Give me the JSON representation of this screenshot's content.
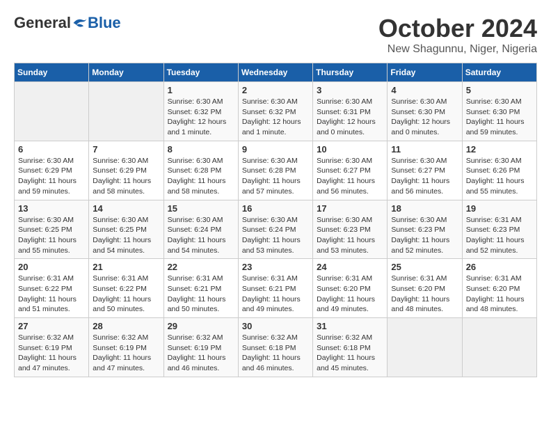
{
  "logo": {
    "general": "General",
    "blue": "Blue"
  },
  "title": "October 2024",
  "location": "New Shagunnu, Niger, Nigeria",
  "days_header": [
    "Sunday",
    "Monday",
    "Tuesday",
    "Wednesday",
    "Thursday",
    "Friday",
    "Saturday"
  ],
  "weeks": [
    [
      {
        "day": "",
        "info": ""
      },
      {
        "day": "",
        "info": ""
      },
      {
        "day": "1",
        "info": "Sunrise: 6:30 AM\nSunset: 6:32 PM\nDaylight: 12 hours\nand 1 minute."
      },
      {
        "day": "2",
        "info": "Sunrise: 6:30 AM\nSunset: 6:32 PM\nDaylight: 12 hours\nand 1 minute."
      },
      {
        "day": "3",
        "info": "Sunrise: 6:30 AM\nSunset: 6:31 PM\nDaylight: 12 hours\nand 0 minutes."
      },
      {
        "day": "4",
        "info": "Sunrise: 6:30 AM\nSunset: 6:30 PM\nDaylight: 12 hours\nand 0 minutes."
      },
      {
        "day": "5",
        "info": "Sunrise: 6:30 AM\nSunset: 6:30 PM\nDaylight: 11 hours\nand 59 minutes."
      }
    ],
    [
      {
        "day": "6",
        "info": "Sunrise: 6:30 AM\nSunset: 6:29 PM\nDaylight: 11 hours\nand 59 minutes."
      },
      {
        "day": "7",
        "info": "Sunrise: 6:30 AM\nSunset: 6:29 PM\nDaylight: 11 hours\nand 58 minutes."
      },
      {
        "day": "8",
        "info": "Sunrise: 6:30 AM\nSunset: 6:28 PM\nDaylight: 11 hours\nand 58 minutes."
      },
      {
        "day": "9",
        "info": "Sunrise: 6:30 AM\nSunset: 6:28 PM\nDaylight: 11 hours\nand 57 minutes."
      },
      {
        "day": "10",
        "info": "Sunrise: 6:30 AM\nSunset: 6:27 PM\nDaylight: 11 hours\nand 56 minutes."
      },
      {
        "day": "11",
        "info": "Sunrise: 6:30 AM\nSunset: 6:27 PM\nDaylight: 11 hours\nand 56 minutes."
      },
      {
        "day": "12",
        "info": "Sunrise: 6:30 AM\nSunset: 6:26 PM\nDaylight: 11 hours\nand 55 minutes."
      }
    ],
    [
      {
        "day": "13",
        "info": "Sunrise: 6:30 AM\nSunset: 6:25 PM\nDaylight: 11 hours\nand 55 minutes."
      },
      {
        "day": "14",
        "info": "Sunrise: 6:30 AM\nSunset: 6:25 PM\nDaylight: 11 hours\nand 54 minutes."
      },
      {
        "day": "15",
        "info": "Sunrise: 6:30 AM\nSunset: 6:24 PM\nDaylight: 11 hours\nand 54 minutes."
      },
      {
        "day": "16",
        "info": "Sunrise: 6:30 AM\nSunset: 6:24 PM\nDaylight: 11 hours\nand 53 minutes."
      },
      {
        "day": "17",
        "info": "Sunrise: 6:30 AM\nSunset: 6:23 PM\nDaylight: 11 hours\nand 53 minutes."
      },
      {
        "day": "18",
        "info": "Sunrise: 6:30 AM\nSunset: 6:23 PM\nDaylight: 11 hours\nand 52 minutes."
      },
      {
        "day": "19",
        "info": "Sunrise: 6:31 AM\nSunset: 6:23 PM\nDaylight: 11 hours\nand 52 minutes."
      }
    ],
    [
      {
        "day": "20",
        "info": "Sunrise: 6:31 AM\nSunset: 6:22 PM\nDaylight: 11 hours\nand 51 minutes."
      },
      {
        "day": "21",
        "info": "Sunrise: 6:31 AM\nSunset: 6:22 PM\nDaylight: 11 hours\nand 50 minutes."
      },
      {
        "day": "22",
        "info": "Sunrise: 6:31 AM\nSunset: 6:21 PM\nDaylight: 11 hours\nand 50 minutes."
      },
      {
        "day": "23",
        "info": "Sunrise: 6:31 AM\nSunset: 6:21 PM\nDaylight: 11 hours\nand 49 minutes."
      },
      {
        "day": "24",
        "info": "Sunrise: 6:31 AM\nSunset: 6:20 PM\nDaylight: 11 hours\nand 49 minutes."
      },
      {
        "day": "25",
        "info": "Sunrise: 6:31 AM\nSunset: 6:20 PM\nDaylight: 11 hours\nand 48 minutes."
      },
      {
        "day": "26",
        "info": "Sunrise: 6:31 AM\nSunset: 6:20 PM\nDaylight: 11 hours\nand 48 minutes."
      }
    ],
    [
      {
        "day": "27",
        "info": "Sunrise: 6:32 AM\nSunset: 6:19 PM\nDaylight: 11 hours\nand 47 minutes."
      },
      {
        "day": "28",
        "info": "Sunrise: 6:32 AM\nSunset: 6:19 PM\nDaylight: 11 hours\nand 47 minutes."
      },
      {
        "day": "29",
        "info": "Sunrise: 6:32 AM\nSunset: 6:19 PM\nDaylight: 11 hours\nand 46 minutes."
      },
      {
        "day": "30",
        "info": "Sunrise: 6:32 AM\nSunset: 6:18 PM\nDaylight: 11 hours\nand 46 minutes."
      },
      {
        "day": "31",
        "info": "Sunrise: 6:32 AM\nSunset: 6:18 PM\nDaylight: 11 hours\nand 45 minutes."
      },
      {
        "day": "",
        "info": ""
      },
      {
        "day": "",
        "info": ""
      }
    ]
  ]
}
